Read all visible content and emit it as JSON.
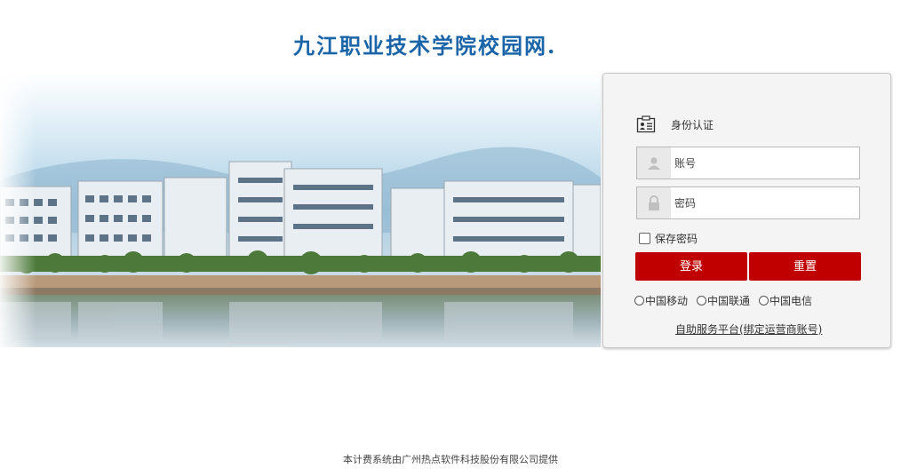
{
  "header": {
    "site_title": "九江职业技术学院校园网."
  },
  "banner": {
    "image_description": "campus-buildings-reflection-photo"
  },
  "login": {
    "auth_label": "身份认证",
    "username_placeholder": "账号",
    "password_placeholder": "密码",
    "remember_label": "保存密码",
    "remember_checked": false,
    "login_button": "登录",
    "reset_button": "重置",
    "isp_options": [
      "中国移动",
      "中国联通",
      "中国电信"
    ],
    "self_service_link": "自助服务平台(绑定运营商账号)"
  },
  "footer": {
    "text": "本计费系统由广州热点软件科技股份有限公司提供"
  },
  "colors": {
    "title": "#1a64a8",
    "button": "#c00000",
    "panel_bg": "#f4f4f4"
  },
  "icons": [
    "id-card-icon",
    "user-icon",
    "lock-icon"
  ]
}
